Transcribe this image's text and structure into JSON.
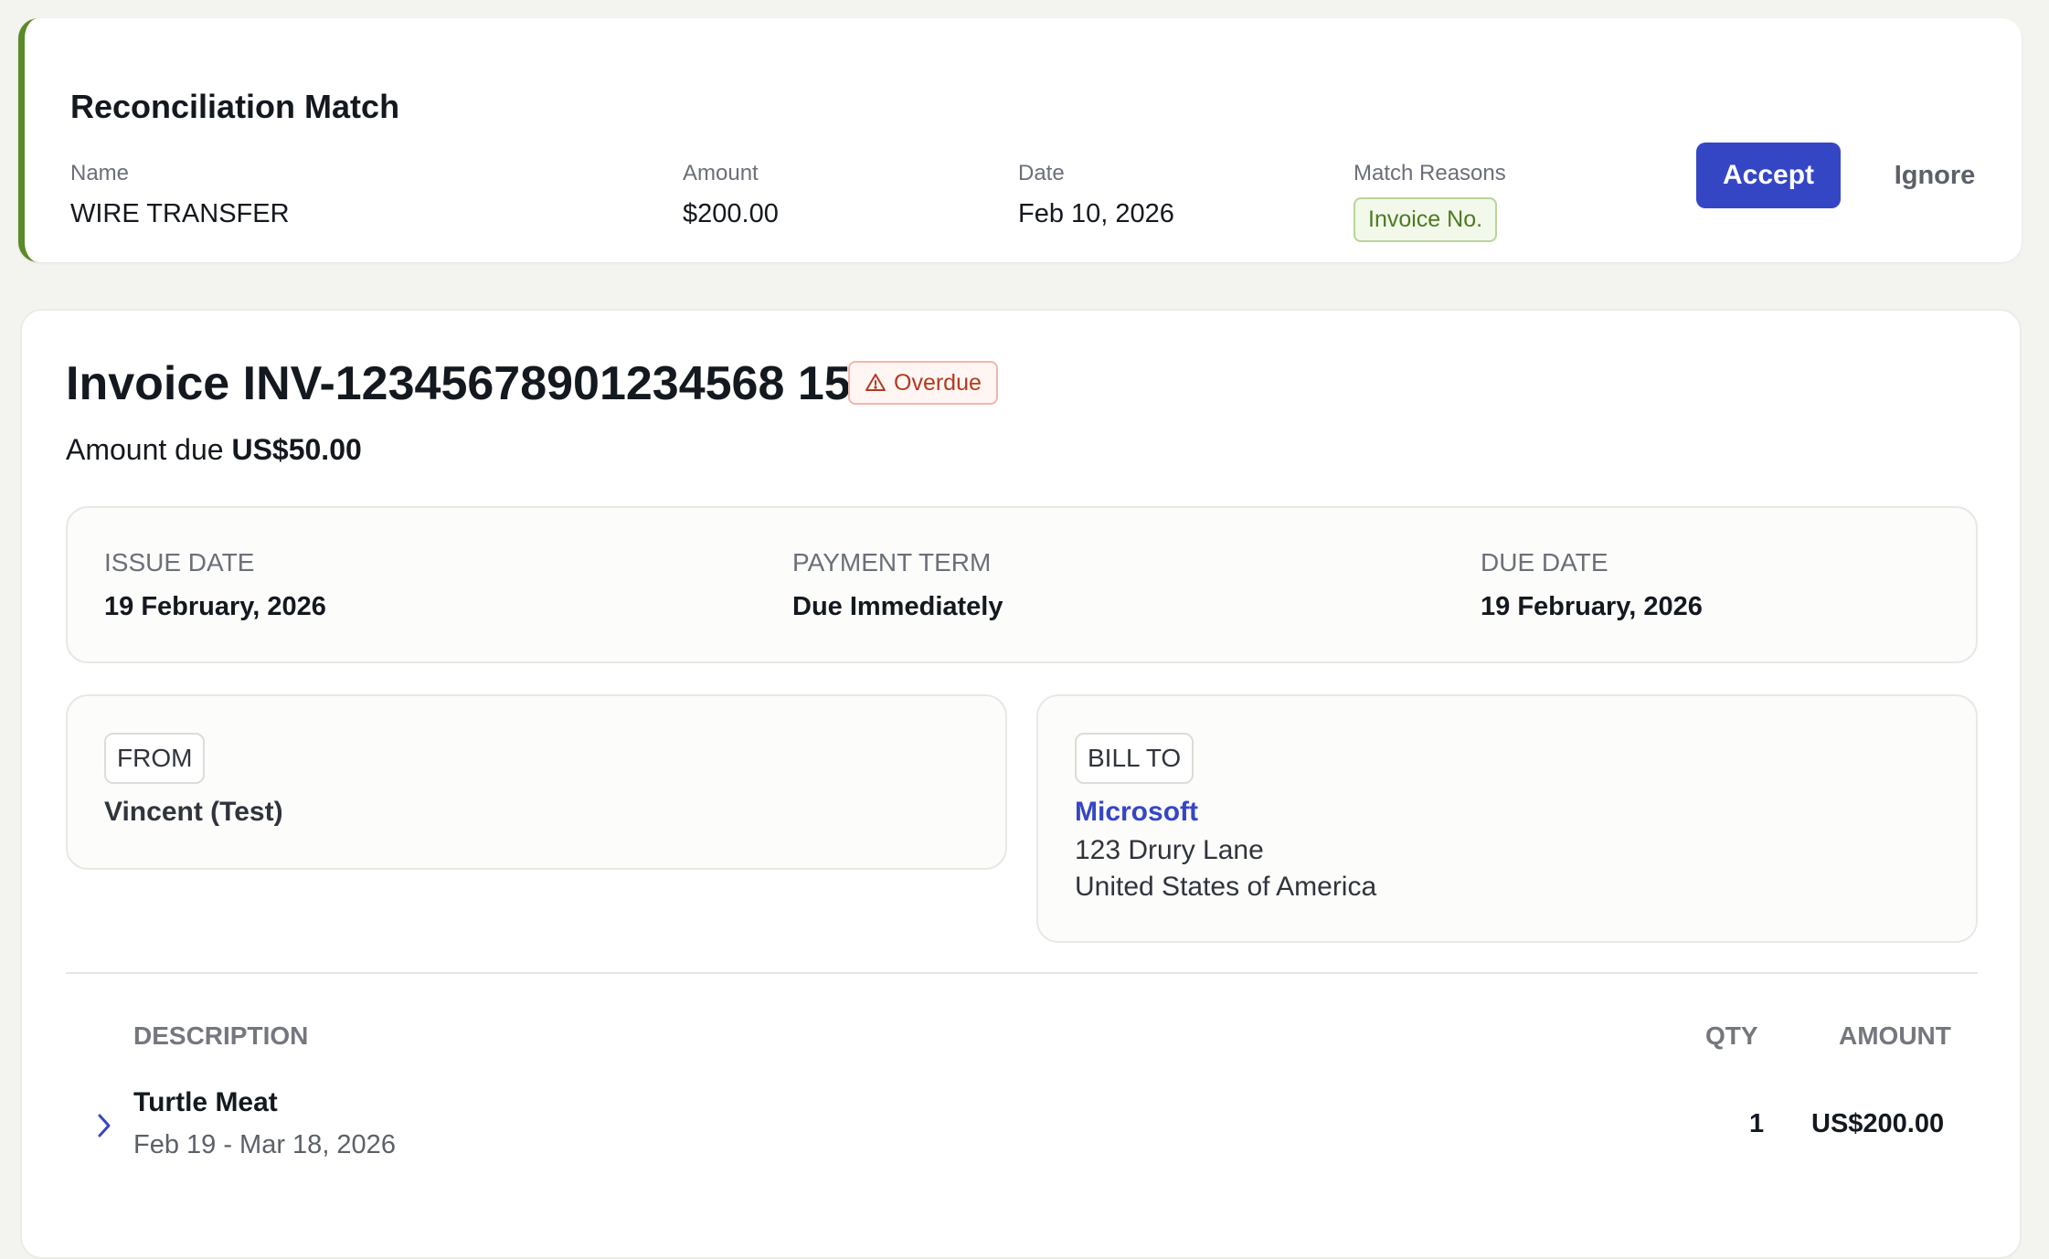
{
  "match": {
    "title": "Reconciliation Match",
    "name_label": "Name",
    "name_value": "WIRE TRANSFER",
    "amount_label": "Amount",
    "amount_value": "$200.00",
    "date_label": "Date",
    "date_value": "Feb 10, 2026",
    "reasons_label": "Match Reasons",
    "reason_badge": "Invoice No.",
    "accept_label": "Accept",
    "ignore_label": "Ignore",
    "accent_color": "#5b8a2a"
  },
  "invoice": {
    "title": "Invoice INV-12345678901234568 15",
    "status_badge": "Overdue",
    "status_icon": "warning-triangle-icon",
    "amount_due_label": "Amount due",
    "amount_due_value": "US$50.00",
    "terms": {
      "issue_date_label": "ISSUE DATE",
      "issue_date_value": "19 February, 2026",
      "payment_term_label": "PAYMENT TERM",
      "payment_term_value": "Due Immediately",
      "due_date_label": "DUE DATE",
      "due_date_value": "19 February, 2026"
    },
    "from": {
      "tag": "FROM",
      "name": "Vincent (Test)"
    },
    "bill_to": {
      "tag": "BILL TO",
      "name": "Microsoft",
      "address_line1": "123 Drury Lane",
      "address_line2": "United States of America"
    },
    "table": {
      "headers": [
        "DESCRIPTION",
        "QTY",
        "AMOUNT"
      ],
      "rows": [
        {
          "description": "Turtle Meat",
          "dates": "Feb 19 - Mar 18, 2026",
          "qty": "1",
          "amount": "US$200.00"
        }
      ]
    },
    "accent_color": "#3546c5"
  }
}
